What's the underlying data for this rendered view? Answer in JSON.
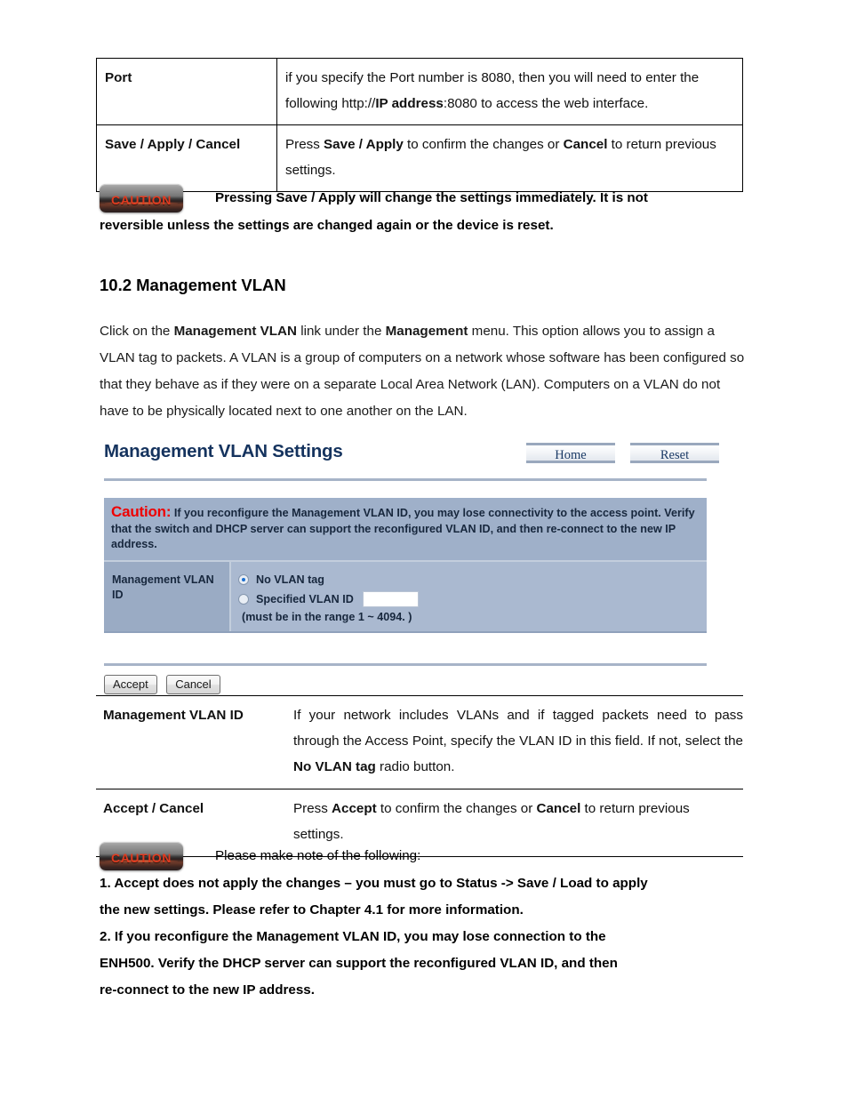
{
  "top_table": {
    "rows": [
      {
        "label": "Port",
        "desc_part1": "if you specify the Port number is 8080, then you will need to enter the following http://",
        "desc_bold1": "IP address",
        "desc_part2": ":8080 to access the web interface."
      },
      {
        "label": "Save / Apply / Cancel",
        "desc_part1": "Press ",
        "desc_bold1": "Save / Apply",
        "desc_part2": " to confirm the changes or ",
        "desc_bold2": "Cancel",
        "desc_part3": " to return previous settings."
      }
    ]
  },
  "caution_badge": {
    "label": "CAUTION"
  },
  "caution_1": {
    "line1": "Pressing Save / Apply will change the settings immediately. It is not",
    "line2": "reversible unless the settings are changed again or the device is reset."
  },
  "section": {
    "heading": "10.2 Management VLAN",
    "paragraph_part1": "Click on the ",
    "paragraph_bold1": "Management VLAN",
    "paragraph_part2": " link under the ",
    "paragraph_bold2": "Management",
    "paragraph_part3": " menu. This option allows you to assign a VLAN tag to packets. A VLAN is a group of computers on a network whose software has been configured so that they behave as if they were on a separate Local Area Network (LAN). Computers on a VLAN do not have to be physically located next to one another on the LAN."
  },
  "ui": {
    "title": "Management VLAN Settings",
    "home_button": "Home",
    "reset_button": "Reset",
    "caution_label": "Caution:",
    "caution_text": " If you reconfigure the Management VLAN ID, you may lose connectivity to the access point. Verify that the switch and DHCP server can support the reconfigured VLAN ID, and then re-connect to the new IP address.",
    "row_label": "Management VLAN ID",
    "option_no_tag": "No VLAN tag",
    "option_specified": "Specified VLAN ID",
    "vlan_input_value": "",
    "range_note": "(must be in the range 1 ~ 4094. )",
    "accept_button": "Accept",
    "cancel_button": "Cancel"
  },
  "bottom_table": {
    "rows": [
      {
        "label": "Management VLAN ID",
        "desc_part1": "If your network includes VLANs and if tagged packets need to pass through the Access Point, specify the VLAN ID in this field. If not, select the ",
        "desc_bold1": "No VLAN tag",
        "desc_part2": " radio button."
      },
      {
        "label": "Accept / Cancel",
        "desc_part1": "Press ",
        "desc_bold1": "Accept",
        "desc_part2": " to confirm the changes or ",
        "desc_bold2": "Cancel",
        "desc_part3": " to return previous settings."
      }
    ]
  },
  "caution_2": {
    "intro": "Please make note of the following:",
    "item1_line1": "1. Accept does not apply the changes – you must go to Status -> Save / Load to apply",
    "item1_line2": "the new settings. Please refer to Chapter 4.1 for more information.",
    "item2_line1": "2. If you reconfigure the Management VLAN ID, you may lose connection to the",
    "item2_line2": "ENH500. Verify the DHCP server can support the reconfigured VLAN ID, and then",
    "item2_line3": "re-connect to the new IP address."
  }
}
